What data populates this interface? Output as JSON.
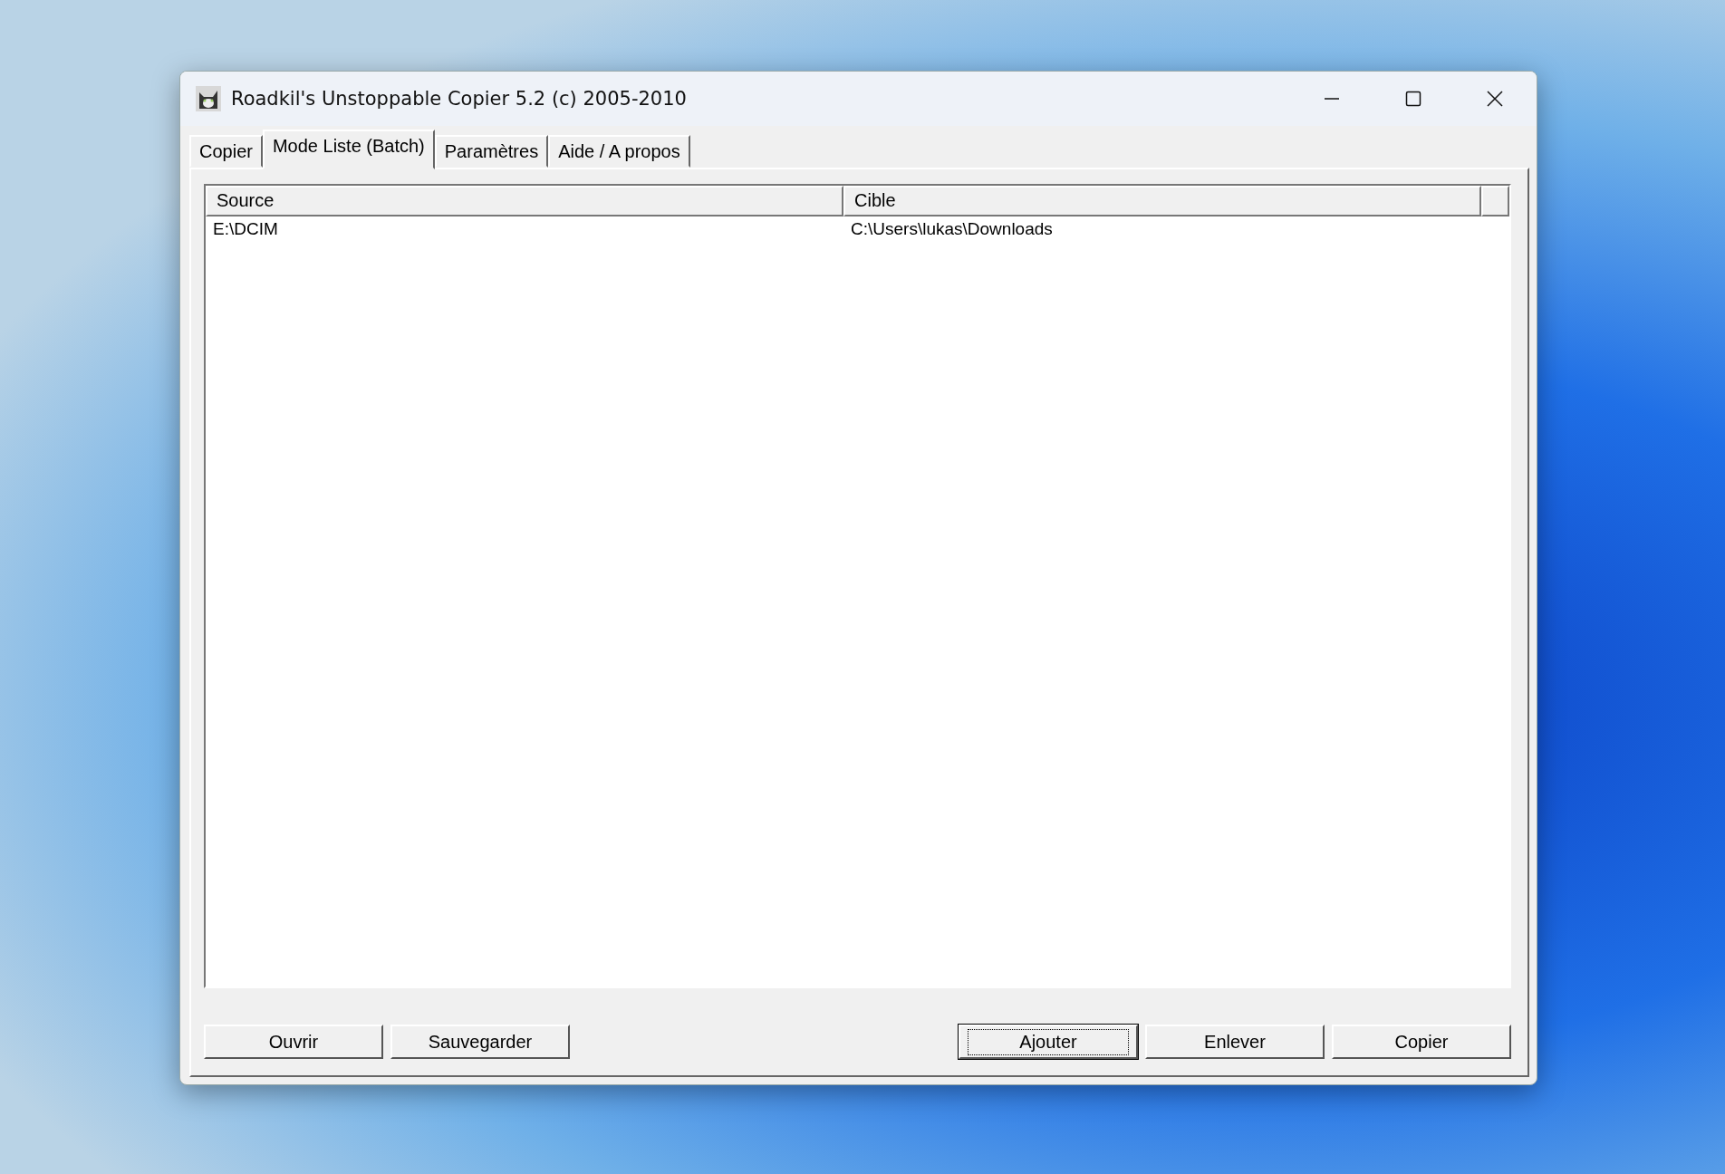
{
  "window": {
    "title": "Roadkil's Unstoppable Copier 5.2 (c) 2005-2010"
  },
  "tabs": [
    {
      "label": "Copier",
      "selected": false
    },
    {
      "label": "Mode Liste (Batch)",
      "selected": true
    },
    {
      "label": "Paramètres",
      "selected": false
    },
    {
      "label": "Aide / A propos",
      "selected": false
    }
  ],
  "table": {
    "columns": [
      "Source",
      "Cible"
    ],
    "rows": [
      {
        "source": "E:\\DCIM",
        "target": "C:\\Users\\lukas\\Downloads"
      }
    ]
  },
  "buttons_left": [
    {
      "label": "Ouvrir",
      "focused": false
    },
    {
      "label": "Sauvegarder",
      "focused": false
    }
  ],
  "buttons_right": [
    {
      "label": "Ajouter",
      "focused": true
    },
    {
      "label": "Enlever",
      "focused": false
    },
    {
      "label": "Copier",
      "focused": false
    }
  ]
}
